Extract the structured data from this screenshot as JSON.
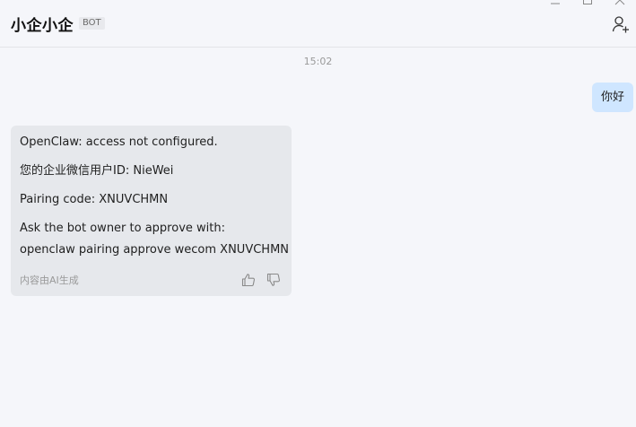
{
  "window": {
    "controls": [
      "minimize",
      "maximize",
      "close"
    ]
  },
  "header": {
    "title": "小企小企",
    "badge": "BOT",
    "add_member_icon": "add-person-icon"
  },
  "messages": {
    "timestamp": "15:02",
    "outgoing": {
      "text": "你好"
    },
    "bot_reply": {
      "line1": "OpenClaw: access not configured.",
      "line2": "您的企业微信用户ID: NieWei",
      "line3": "Pairing code: XNUVCHMN",
      "line4": "Ask the bot owner to approve with:",
      "line5": "openclaw pairing approve wecom XNUVCHMN",
      "ai_note": "内容由AI生成",
      "like_icon": "thumbs-up-icon",
      "dislike_icon": "thumbs-down-icon"
    }
  },
  "colors": {
    "background": "#f5f6fa",
    "outgoing_bubble": "#cfe6ff",
    "bot_card": "#e6e8ec"
  }
}
